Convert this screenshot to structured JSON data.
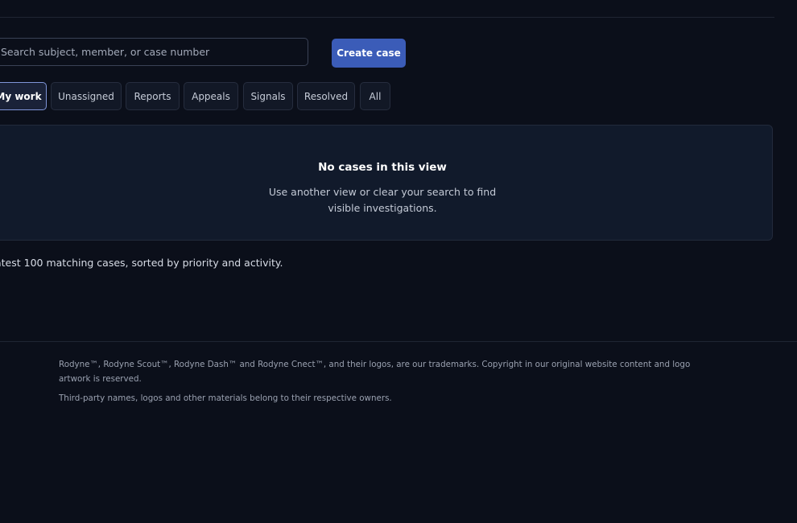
{
  "search": {
    "placeholder": "Search subject, member, or case number",
    "value": ""
  },
  "actions": {
    "create_label": "Create case"
  },
  "tabs": [
    {
      "label": "My work",
      "active": true
    },
    {
      "label": "Unassigned",
      "active": false
    },
    {
      "label": "Reports",
      "active": false
    },
    {
      "label": "Appeals",
      "active": false
    },
    {
      "label": "Signals",
      "active": false
    },
    {
      "label": "Resolved",
      "active": false
    },
    {
      "label": "All",
      "active": false
    }
  ],
  "empty_state": {
    "title": "No cases in this view",
    "message": "Use another view or clear your search to find visible investigations."
  },
  "results_note": "atest 100 matching cases, sorted by priority and activity.",
  "footer": {
    "trademark": "Rodyne™, Rodyne Scout™, Rodyne Dash™ and Rodyne Cnect™, and their logos, are our trademarks. Copyright in our original website content and logo artwork is reserved.",
    "third_party": "Third-party names, logos and other materials belong to their respective owners."
  },
  "colors": {
    "background": "#0b0f1a",
    "accent": "#3b5cb8",
    "active_tab_border": "#7f95d8"
  }
}
